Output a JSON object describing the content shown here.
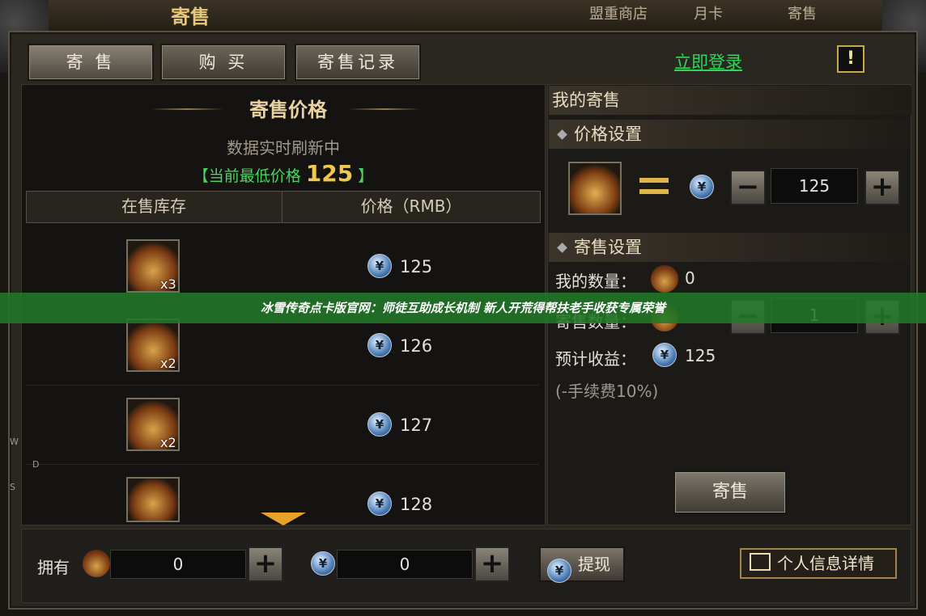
{
  "window": {
    "title": "寄售"
  },
  "top_nav": [
    "盟重商店",
    "月卡",
    "寄售"
  ],
  "tabs": [
    {
      "label": "寄 售"
    },
    {
      "label": "购 买"
    },
    {
      "label": "寄售记录"
    }
  ],
  "login_link": "立即登录",
  "warning_icon": "!",
  "left": {
    "title": "寄售价格",
    "refresh_text": "数据实时刷新中",
    "lowest_prefix": "【当前最低价格",
    "lowest_value": "125",
    "lowest_suffix": "】",
    "columns": [
      "在售库存",
      "价格（RMB）"
    ],
    "rows": [
      {
        "qty": "x3",
        "price": "125"
      },
      {
        "qty": "x2",
        "price": "126"
      },
      {
        "qty": "x2",
        "price": "127"
      },
      {
        "qty": "",
        "price": "128"
      }
    ]
  },
  "right": {
    "title": "我的寄售",
    "price_section": "价格设置",
    "price_value": "125",
    "sale_section": "寄售设置",
    "my_qty_label": "我的数量：",
    "my_qty_value": "0",
    "sale_qty_label": "寄售数量：",
    "sale_qty_value": "1",
    "income_label": "预计收益：",
    "income_value": "125",
    "fee_note": "(-手续费10%)",
    "sell_button": "寄售"
  },
  "bottom": {
    "own_label": "拥有",
    "item_count": "0",
    "coin_count": "0",
    "withdraw_label": "提现",
    "info_label": "个人信息详情"
  },
  "banner": "冰雪传奇点卡版官网：师徒互助成长机制 新人开荒得帮扶老手收获专属荣誉",
  "side_letters": [
    "W",
    "D",
    "S"
  ],
  "icons": {
    "currency": "¥",
    "plus": "+",
    "minus": "−"
  },
  "colors": {
    "accent_gold": "#e0b64a",
    "login_green": "#2fd65a",
    "banner_green": "#227828"
  }
}
